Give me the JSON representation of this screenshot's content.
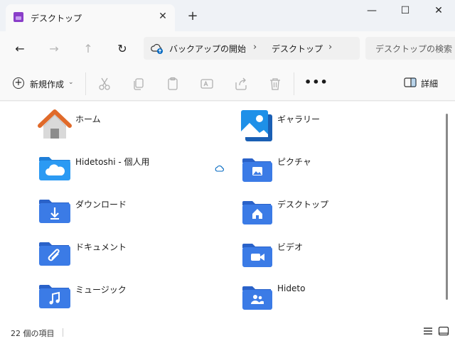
{
  "window": {
    "tab_title": "デスクトップ",
    "tab_close": "✕",
    "new_tab": "+",
    "minimize": "—",
    "maximize": "☐",
    "close": "✕"
  },
  "nav": {
    "back": "←",
    "forward": "→",
    "up": "↑",
    "refresh": "↻",
    "breadcrumb": [
      "バックアップの開始",
      "デスクトップ"
    ],
    "sep": "›",
    "search_placeholder": "デスクトップの検索"
  },
  "toolbar": {
    "new_label": "新規作成",
    "new_chevron": "⌄",
    "more": "•••",
    "details_label": "詳細",
    "icons": [
      "cut-icon",
      "copy-icon",
      "paste-icon",
      "rename-icon",
      "share-icon",
      "delete-icon"
    ]
  },
  "items": [
    {
      "name": "ホーム",
      "icon": "home-icon"
    },
    {
      "name": "ギャラリー",
      "icon": "gallery-icon"
    },
    {
      "name": "Hidetoshi - 個人用",
      "icon": "onedrive-folder-icon"
    },
    {
      "name": "ピクチャ",
      "icon": "pictures-folder-icon"
    },
    {
      "name": "ダウンロード",
      "icon": "downloads-folder-icon"
    },
    {
      "name": "デスクトップ",
      "icon": "desktop-folder-icon"
    },
    {
      "name": "ドキュメント",
      "icon": "documents-folder-icon"
    },
    {
      "name": "ビデオ",
      "icon": "videos-folder-icon"
    },
    {
      "name": "ミュージック",
      "icon": "music-folder-icon"
    },
    {
      "name": "Hideto",
      "icon": "user-folder-icon"
    }
  ],
  "status": {
    "count": "22 個の項目"
  },
  "colors": {
    "folder": "#3b7be6",
    "folder_dark": "#2a62c9",
    "accent": "#0067c0"
  }
}
